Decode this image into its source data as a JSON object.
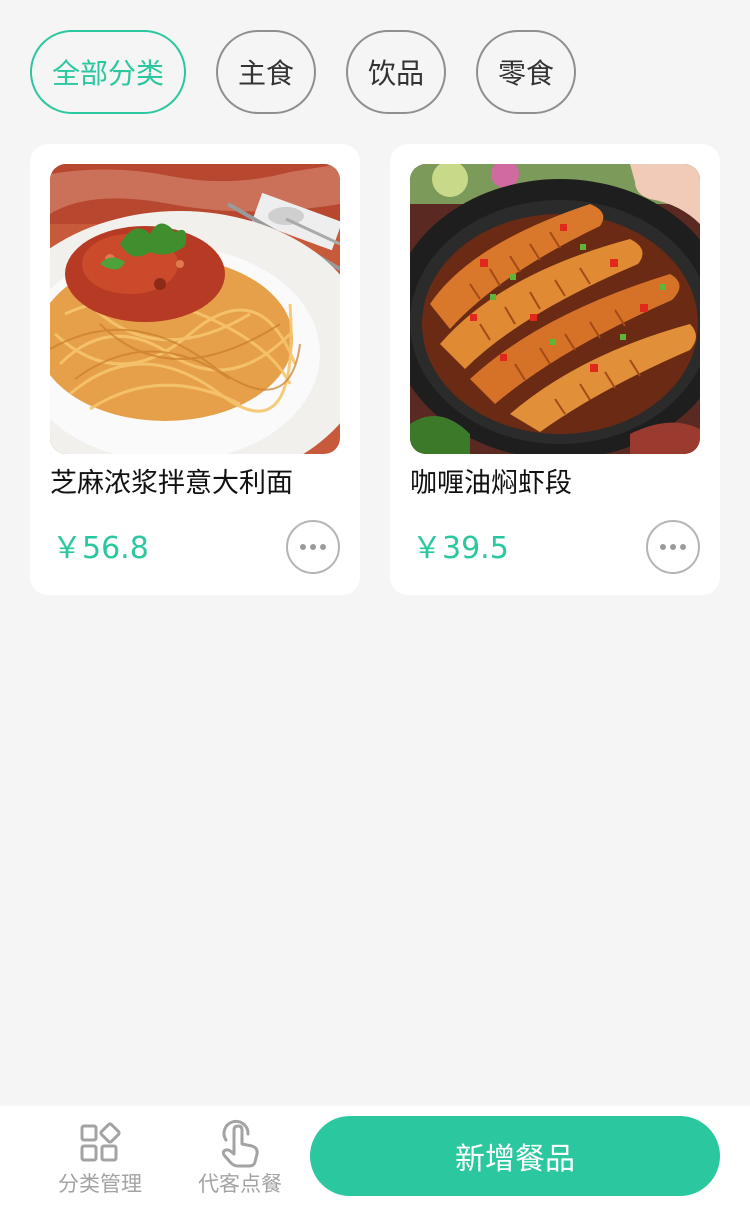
{
  "categories": {
    "active_index": 0,
    "items": [
      {
        "label": "全部分类"
      },
      {
        "label": "主食"
      },
      {
        "label": "饮品"
      },
      {
        "label": "零食"
      }
    ]
  },
  "dishes": [
    {
      "name": "芝麻浓浆拌意大利面",
      "price": "￥56.8"
    },
    {
      "name": "咖喱油焖虾段",
      "price": "￥39.5"
    }
  ],
  "bottom_bar": {
    "tabs": [
      {
        "label": "分类管理",
        "icon": "grid-icon"
      },
      {
        "label": "代客点餐",
        "icon": "tap-hand-icon"
      }
    ],
    "add_button_label": "新增餐品"
  },
  "colors": {
    "accent": "#2bc79e",
    "background": "#f5f5f5",
    "chip_border": "#8f8f8f",
    "muted_text": "#a3a3a3"
  }
}
